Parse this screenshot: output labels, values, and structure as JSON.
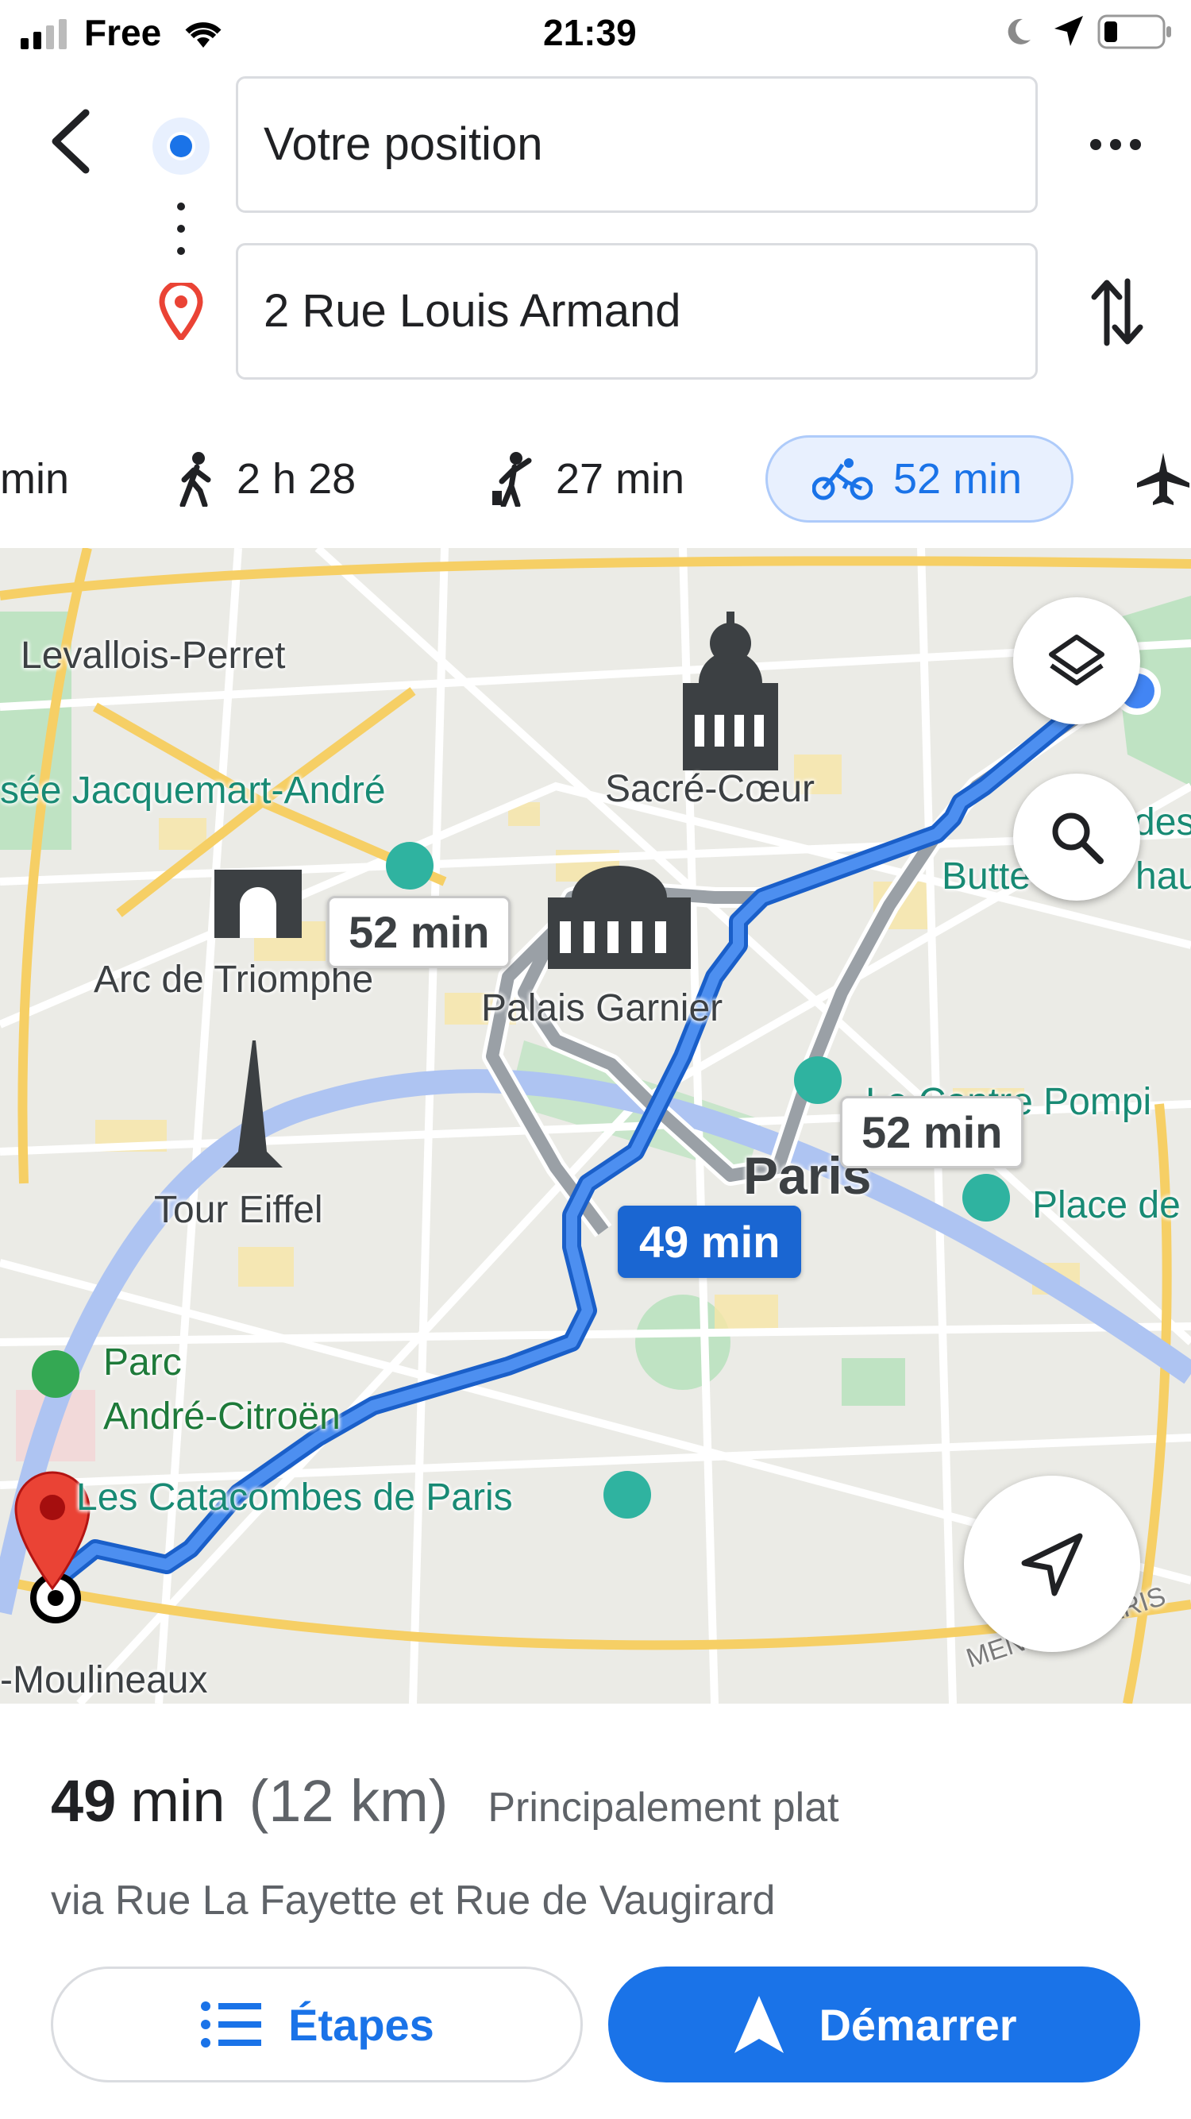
{
  "status_bar": {
    "carrier": "Free",
    "time": "21:39"
  },
  "directions": {
    "origin": "Votre position",
    "destination": "2 Rue Louis Armand"
  },
  "modes": [
    {
      "name": "car",
      "time": "min"
    },
    {
      "name": "walk",
      "time": "2 h 28"
    },
    {
      "name": "ride",
      "time": "27 min"
    },
    {
      "name": "bike",
      "time": "52 min",
      "selected": true
    },
    {
      "name": "flight",
      "time": ""
    }
  ],
  "map": {
    "labels": {
      "levallois": "Levallois-Perret",
      "jacquemart": "sée Jacquemart-André",
      "sacre_coeur": "Sacré-Cœur",
      "buttes": "Butte",
      "buttes2": "hau",
      "des": "des",
      "arc": "Arc de Triomphe",
      "garnier": "Palais Garnier",
      "pompidou": "Le Centre Pompi",
      "paris": "Paris",
      "place": "Place de",
      "eiffel": "Tour Eiffel",
      "parc1": "Parc",
      "parc2": "André-Citroën",
      "catacombes": "Les Catacombes de Paris",
      "moulineaux": "-Moulineaux",
      "peripherique": "MENT DE PARIS"
    },
    "callouts": {
      "alt1": "52 min",
      "alt2": "52 min",
      "main": "49 min"
    }
  },
  "summary": {
    "duration": "49",
    "unit": "min",
    "distance": "(12 km)",
    "terrain": "Principalement plat",
    "via": "via Rue La Fayette et Rue de Vaugirard"
  },
  "actions": {
    "steps": "Étapes",
    "start": "Démarrer"
  },
  "colors": {
    "accent": "#1a73e8",
    "route": "#4285f4",
    "alt_route": "#9aa0a6",
    "pin": "#ea4335"
  }
}
